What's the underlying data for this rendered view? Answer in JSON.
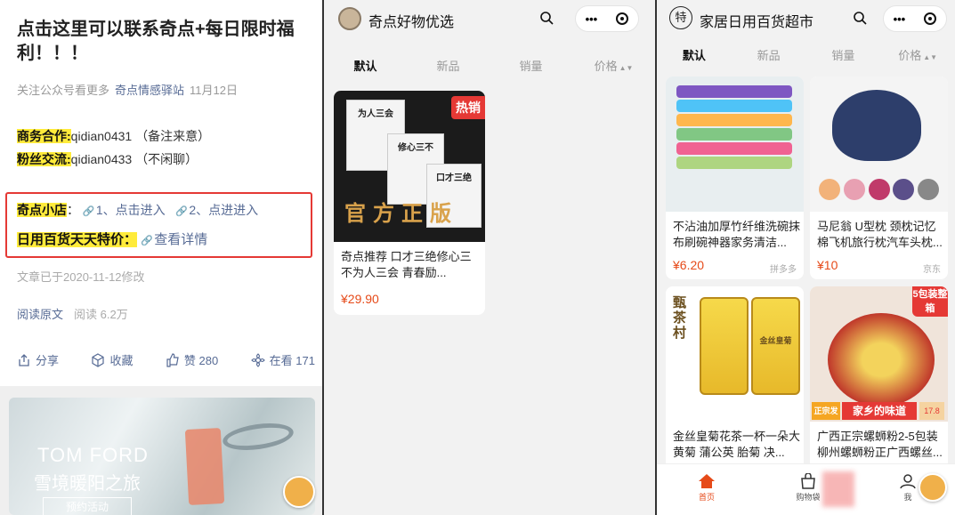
{
  "panel1": {
    "title": "点击这里可以联系奇点+每日限时福利！！！",
    "meta": {
      "prefix": "关注公众号看更多",
      "account": "奇点情感驿站",
      "date": "11月12日"
    },
    "business": {
      "label": "商务合作:",
      "value": "qidian0431 （备注来意）"
    },
    "fans": {
      "label": "粉丝交流:",
      "value": "qidian0433 （不闲聊）"
    },
    "shop": {
      "label": "奇点小店",
      "sep": "：",
      "link1": "1、点击进入",
      "link2": "2、点进进入"
    },
    "daily": {
      "label": "日用百货天天特价：",
      "link": "查看详情"
    },
    "edited": "文章已于2020-11-12修改",
    "read_original": "阅读原文",
    "read_count": "阅读 6.2万",
    "actions": {
      "share": "分享",
      "collect": "收藏",
      "like": "赞 280",
      "watching": "在看 171"
    },
    "ad": {
      "brand": "TOM FORD",
      "slogan": "雪境暖阳之旅",
      "button": "预约活动"
    }
  },
  "panel2": {
    "store_name": "奇点好物优选",
    "tabs": [
      "默认",
      "新品",
      "销量",
      "价格"
    ],
    "product": {
      "badge": "热销",
      "image_text": "官方正版",
      "books": [
        "为人三会",
        "修心三不",
        "口才三绝"
      ],
      "title": "奇点推荐 口才三绝修心三不为人三会 青春励...",
      "price": "¥29.90"
    }
  },
  "panel3": {
    "store_icon": "特",
    "store_name": "家居日用百货超市",
    "tabs": [
      "默认",
      "新品",
      "销量",
      "价格"
    ],
    "products": [
      {
        "title": "不沾油加厚竹纤维洗碗抹布刷碗神器家务清洁...",
        "price": "¥6.20",
        "source": "拼多多"
      },
      {
        "title": "马尼翁 U型枕 颈枕记忆棉飞机旅行枕汽车头枕...",
        "price": "¥10",
        "source": "京东"
      },
      {
        "title": "金丝皇菊花茶一杯一朵大黄菊 蒲公英 胎菊 决...",
        "image_text": "甄茶村",
        "jar_label": "金丝皇菊"
      },
      {
        "title": "广西正宗螺蛳粉2-5包装柳州螺蛳粉正广西螺丝...",
        "badge": "5包装整箱",
        "banner": "家乡的味道",
        "tag": "正宗发货",
        "price_tag": "17.8"
      }
    ],
    "nav": {
      "home": "首页",
      "bag": "购物袋",
      "me": "我"
    }
  },
  "colors": {
    "accent": "#e64a19",
    "link": "#576b95",
    "highlight": "#ffeb3b",
    "box": "#e53935"
  }
}
